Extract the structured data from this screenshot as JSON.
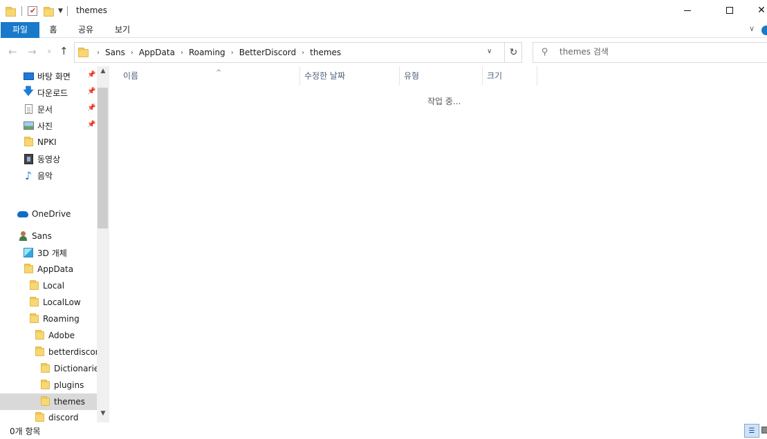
{
  "window": {
    "title": "themes",
    "qat_dropdown_icon": "chevron-down-icon"
  },
  "ribbon": {
    "tabs": [
      {
        "label": "파일"
      },
      {
        "label": "홈"
      },
      {
        "label": "공유"
      },
      {
        "label": "보기"
      }
    ],
    "accent": "#1979ca"
  },
  "address": {
    "crumbs": [
      "Sans",
      "AppData",
      "Roaming",
      "BetterDiscord",
      "themes"
    ]
  },
  "search": {
    "placeholder": "themes 검색"
  },
  "nav": {
    "quick_access": [
      {
        "label": "바탕 화면",
        "pinned": true,
        "icon": "desktop-icon"
      },
      {
        "label": "다운로드",
        "pinned": true,
        "icon": "download-icon"
      },
      {
        "label": "문서",
        "pinned": true,
        "icon": "document-icon"
      },
      {
        "label": "사진",
        "pinned": true,
        "icon": "picture-icon"
      },
      {
        "label": "NPKI",
        "pinned": false,
        "icon": "folder-icon"
      },
      {
        "label": "동영상",
        "pinned": false,
        "icon": "video-icon"
      },
      {
        "label": "음악",
        "pinned": false,
        "icon": "music-icon"
      }
    ],
    "onedrive": {
      "label": "OneDrive",
      "icon": "cloud-icon"
    },
    "user_tree": [
      {
        "label": "Sans",
        "icon": "user-icon"
      },
      {
        "label": "3D 개체",
        "icon": "3d-objects-icon"
      },
      {
        "label": "AppData",
        "icon": "folder-icon"
      },
      {
        "label": "Local",
        "icon": "folder-icon"
      },
      {
        "label": "LocalLow",
        "icon": "folder-icon"
      },
      {
        "label": "Roaming",
        "icon": "folder-icon"
      },
      {
        "label": "Adobe",
        "icon": "folder-icon"
      },
      {
        "label": "betterdiscord",
        "icon": "folder-icon"
      },
      {
        "label": "Dictionaries",
        "icon": "folder-icon"
      },
      {
        "label": "plugins",
        "icon": "folder-icon"
      },
      {
        "label": "themes",
        "icon": "folder-icon",
        "selected": true
      },
      {
        "label": "discord",
        "icon": "folder-icon"
      }
    ]
  },
  "columns": {
    "name": "이름",
    "date": "수정한 날짜",
    "type": "유형",
    "size": "크기"
  },
  "content": {
    "status_message": "작업 중..."
  },
  "status": {
    "item_count": "0개 항목"
  }
}
